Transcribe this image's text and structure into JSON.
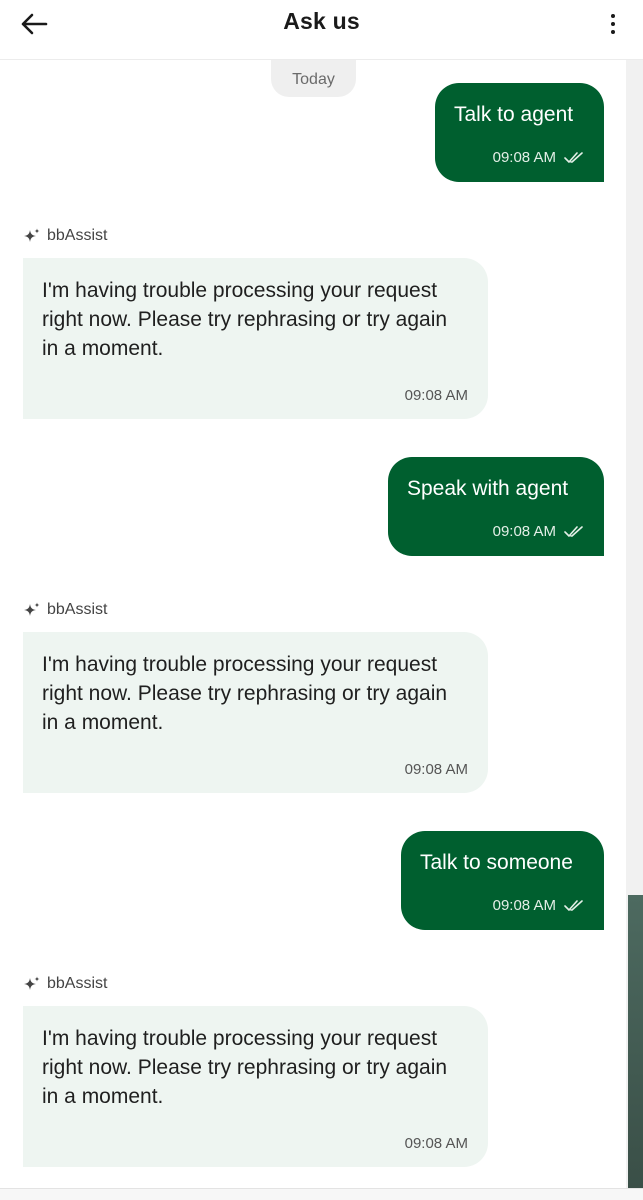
{
  "header": {
    "title": "Ask us",
    "back_icon": "arrow-left-icon",
    "more_icon": "more-vertical-icon"
  },
  "date_separator": "Today",
  "colors": {
    "outgoing_bubble": "#005f2f",
    "incoming_bubble": "#eef5f1"
  },
  "messages": [
    {
      "type": "outgoing",
      "text": "Talk to agent",
      "time": "09:08 AM",
      "status_icon": "double-check-icon"
    },
    {
      "type": "incoming",
      "sender": "bbAssist",
      "sender_icon": "sparkle-icon",
      "text": "I'm having trouble processing your request right now. Please try rephrasing or try again in a moment.",
      "time": "09:08 AM"
    },
    {
      "type": "outgoing",
      "text": "Speak with agent",
      "time": "09:08 AM",
      "status_icon": "double-check-icon"
    },
    {
      "type": "incoming",
      "sender": "bbAssist",
      "sender_icon": "sparkle-icon",
      "text": "I'm having trouble processing your request right now. Please try rephrasing or try again in a moment.",
      "time": "09:08 AM"
    },
    {
      "type": "outgoing",
      "text": "Talk to someone",
      "time": "09:08 AM",
      "status_icon": "double-check-icon"
    },
    {
      "type": "incoming",
      "sender": "bbAssist",
      "sender_icon": "sparkle-icon",
      "text": "I'm having trouble processing your request right now. Please try rephrasing or try again in a moment.",
      "time": "09:08 AM"
    }
  ]
}
